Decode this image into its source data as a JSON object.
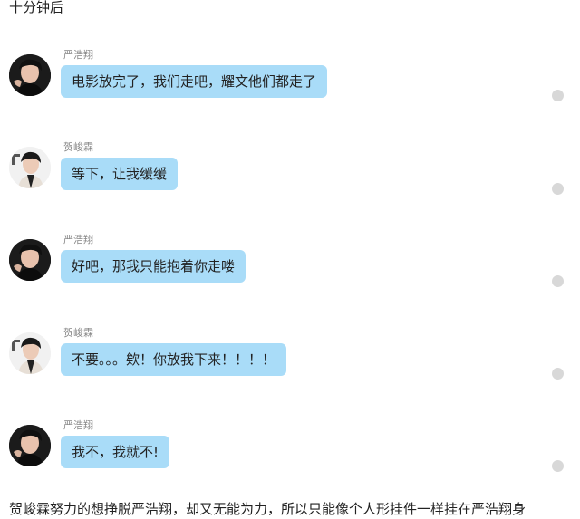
{
  "scene": {
    "caption": "十分钟后"
  },
  "messages": [
    {
      "sender": "严浩翔",
      "text": "电影放完了，我们走吧，耀文他们都走了",
      "avatar": "yan-haoxiang-avatar"
    },
    {
      "sender": "贺峻霖",
      "text": "等下，让我缓缓",
      "avatar": "he-junlin-avatar"
    },
    {
      "sender": "严浩翔",
      "text": "好吧，那我只能抱着你走喽",
      "avatar": "yan-haoxiang-avatar"
    },
    {
      "sender": "贺峻霖",
      "text": "不要。。。欸！你放我下来！！！！",
      "avatar": "he-junlin-avatar"
    },
    {
      "sender": "严浩翔",
      "text": "我不，我就不!",
      "avatar": "yan-haoxiang-avatar"
    }
  ],
  "narration": "贺峻霖努力的想挣脱严浩翔，却又无能为力，所以只能像个人形挂件一样挂在严浩翔身",
  "colors": {
    "bubble": "#a9dcf8",
    "name": "#888888",
    "dot": "#d8d8d8",
    "text": "#222222"
  }
}
